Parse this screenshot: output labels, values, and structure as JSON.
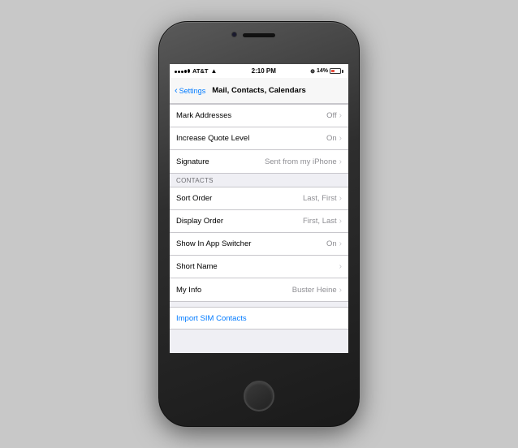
{
  "phone": {
    "status_bar": {
      "carrier": "AT&T",
      "time": "2:10 PM",
      "battery_percent": "14%"
    },
    "nav": {
      "back_label": "Settings",
      "title": "Mail, Contacts, Calendars"
    },
    "mail_section": {
      "items": [
        {
          "label": "Mark Addresses",
          "value": "Off"
        },
        {
          "label": "Increase Quote Level",
          "value": "On"
        },
        {
          "label": "Signature",
          "value": "Sent from my iPhone"
        }
      ]
    },
    "contacts_section": {
      "header": "CONTACTS",
      "items": [
        {
          "label": "Sort Order",
          "value": "Last, First"
        },
        {
          "label": "Display Order",
          "value": "First, Last"
        },
        {
          "label": "Show In App Switcher",
          "value": "On"
        },
        {
          "label": "Short Name",
          "value": ""
        },
        {
          "label": "My Info",
          "value": "Buster Heine"
        }
      ]
    },
    "import_sim": {
      "label": "Import SIM Contacts"
    }
  }
}
